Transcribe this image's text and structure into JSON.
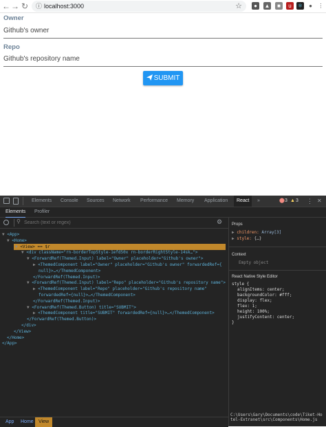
{
  "browser": {
    "url": "localhost:3000",
    "lock_icon": "info-icon",
    "extensions": [
      "shield-icon",
      "vpn-icon",
      "notes-icon",
      "ublock-icon",
      "react-icon",
      "redux-icon",
      "account-icon",
      "menu-icon"
    ]
  },
  "form": {
    "owner_label": "Owner",
    "owner_placeholder": "Github's owner",
    "repo_label": "Repo",
    "repo_placeholder": "Github's repository name",
    "submit_label": "SUBMIT",
    "submit_color": "#2196f3"
  },
  "devtools": {
    "tabs": [
      "Elements",
      "Console",
      "Sources",
      "Network",
      "Performance",
      "Memory",
      "Application",
      "React"
    ],
    "active_tab": "React",
    "more": "»",
    "errors": "3",
    "warnings": "3",
    "subtabs": [
      "Elements",
      "Profiler"
    ],
    "search_placeholder": "Search (text or regex)",
    "tree": [
      {
        "open": "▼",
        "text": "<App>"
      },
      {
        "open": "▼",
        "text": "<Home>"
      },
      {
        "open": "▼",
        "text": "<View> == $r"
      },
      {
        "open": "▼",
        "text": "<div className=\"rn-borderTopStyle-1efd50x rn-borderRightStyle-14sk…\">"
      },
      {
        "open": "▼",
        "text": "<ForwardRef(Themed.Input) label=\"Owner\" placeholder=\"Github's owner\">"
      },
      {
        "open": "▶",
        "text": "<ThemedComponent label=\"Owner\" placeholder=\"Github's owner\" forwardedRef={"
      },
      {
        "open": "",
        "text": "null}>…</ThemedComponent>"
      },
      {
        "open": "",
        "text": "</ForwardRef(Themed.Input)>"
      },
      {
        "open": "▼",
        "text": "<ForwardRef(Themed.Input) label=\"Repo\" placeholder=\"Github's repository name\">"
      },
      {
        "open": "▶",
        "text": "<ThemedComponent label=\"Repo\" placeholder=\"Github's repository name\""
      },
      {
        "open": "",
        "text": "forwardedRef={null}>…</ThemedComponent>"
      },
      {
        "open": "",
        "text": "</ForwardRef(Themed.Input)>"
      },
      {
        "open": "▼",
        "text": "<ForwardRef(Themed.Button) title=\"SUBMIT\">"
      },
      {
        "open": "▶",
        "text": "<ThemedComponent title=\"SUBMIT\" forwardedRef={null}>…</ThemedComponent>"
      },
      {
        "open": "",
        "text": "</ForwardRef(Themed.Button)>"
      },
      {
        "open": "",
        "text": "</div>"
      },
      {
        "open": "",
        "text": "</View>"
      },
      {
        "open": "",
        "text": "</Home>"
      },
      {
        "open": "",
        "text": "</App>"
      }
    ],
    "props_title": "Props",
    "prop_children_key": "children:",
    "prop_children_val": "Array[3]",
    "prop_style_key": "style:",
    "prop_style_val": "{…}",
    "context_title": "Context",
    "context_empty": "Empty object",
    "style_editor_title": "React Native Style Editor",
    "style_open": "style {",
    "style_props": [
      "alignItems:  center;",
      "backgroundColor:  #fff;",
      "display:  flex;",
      "flex:  1;",
      "height:  100%;",
      "justifyContent:  center;"
    ],
    "style_close": "}",
    "source_path": "C:\\Users\\Gary\\Documents\\code\\Tiket-Hotel-Extranet\\src\\Components\\Home.js",
    "breadcrumbs": [
      "App",
      "Home",
      "View"
    ],
    "active_breadcrumb": "View"
  }
}
